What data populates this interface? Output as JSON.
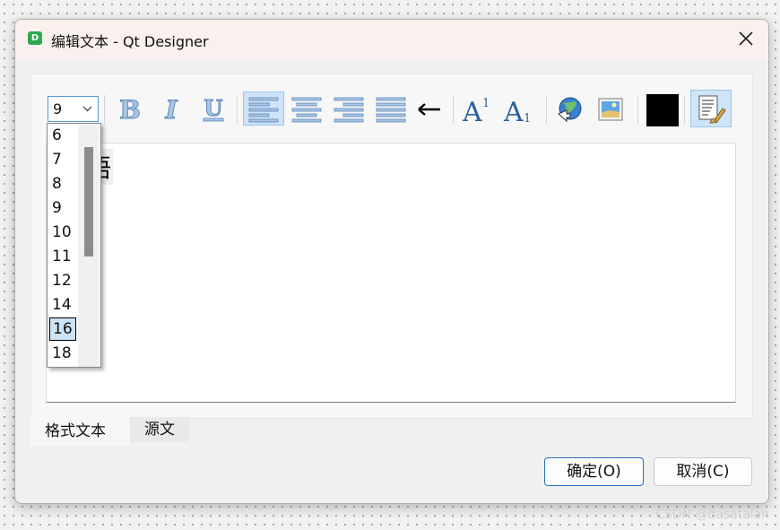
{
  "window": {
    "title": "编辑文本 - Qt Designer",
    "icon_letter": "D",
    "close_icon": "close-icon"
  },
  "toolbar": {
    "font_size": "9",
    "buttons": [
      {
        "name": "bold",
        "icon": "bold-icon",
        "active": false
      },
      {
        "name": "italic",
        "icon": "italic-icon",
        "active": false
      },
      {
        "name": "underline",
        "icon": "underline-icon",
        "active": false
      },
      {
        "name": "align-left",
        "icon": "align-left-icon",
        "active": true
      },
      {
        "name": "align-center",
        "icon": "align-center-icon",
        "active": false
      },
      {
        "name": "align-right",
        "icon": "align-right-icon",
        "active": false
      },
      {
        "name": "justify",
        "icon": "align-justify-icon",
        "active": false
      },
      {
        "name": "text-direction",
        "icon": "arrow-left-icon",
        "active": false
      },
      {
        "name": "superscript",
        "icon": "superscript-icon",
        "active": false
      },
      {
        "name": "subscript",
        "icon": "subscript-icon",
        "active": false
      },
      {
        "name": "insert-link",
        "icon": "globe-link-icon",
        "active": false
      },
      {
        "name": "insert-image",
        "icon": "image-icon",
        "active": false
      },
      {
        "name": "text-color",
        "icon": "color-swatch-icon",
        "active": false,
        "color": "#000000"
      },
      {
        "name": "simplify-richtext",
        "icon": "document-brush-icon",
        "active": true
      }
    ]
  },
  "editor": {
    "visible_text": "悟"
  },
  "font_size_dropdown": {
    "options": [
      "6",
      "7",
      "8",
      "9",
      "10",
      "11",
      "12",
      "14",
      "16",
      "18"
    ],
    "selected": "16"
  },
  "tabs": [
    {
      "label": "格式文本",
      "selected": true
    },
    {
      "label": "源文",
      "selected": false
    }
  ],
  "buttons": {
    "ok": "确定(O)",
    "cancel": "取消(C)"
  },
  "watermark": "CSDN @dasatalan",
  "colors": {
    "accent": "#1d70c2",
    "active_button_bg": "#cfe4f7",
    "app_icon": "#2fa84f"
  }
}
